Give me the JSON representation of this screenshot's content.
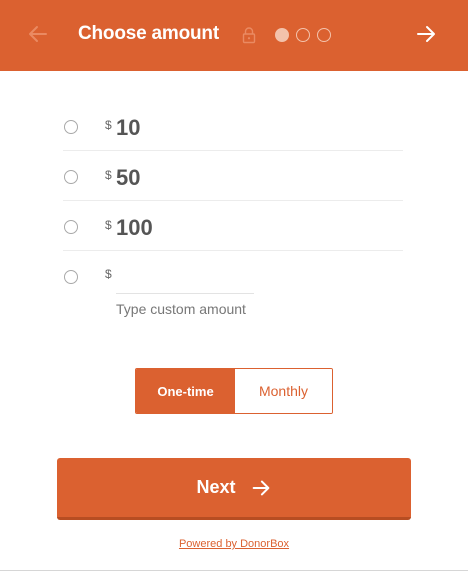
{
  "header": {
    "title": "Choose amount",
    "back_icon": "arrow-left-icon",
    "lock_icon": "lock-icon",
    "next_icon": "arrow-right-icon",
    "steps": [
      {
        "active": true
      },
      {
        "active": false
      },
      {
        "active": false
      }
    ]
  },
  "amounts": [
    {
      "currency": "$",
      "value": "10"
    },
    {
      "currency": "$",
      "value": "50"
    },
    {
      "currency": "$",
      "value": "100"
    }
  ],
  "custom": {
    "currency": "$",
    "placeholder": "Type custom amount",
    "value": ""
  },
  "frequency": {
    "options": [
      "One-time",
      "Monthly"
    ],
    "selected": "One-time"
  },
  "next_button": {
    "label": "Next",
    "icon": "arrow-right-icon"
  },
  "footer": {
    "powered_by": "Powered by DonorBox"
  },
  "colors": {
    "accent": "#db6130",
    "accent_dark": "#b74d22",
    "step_dot": "#f3c2ab"
  }
}
